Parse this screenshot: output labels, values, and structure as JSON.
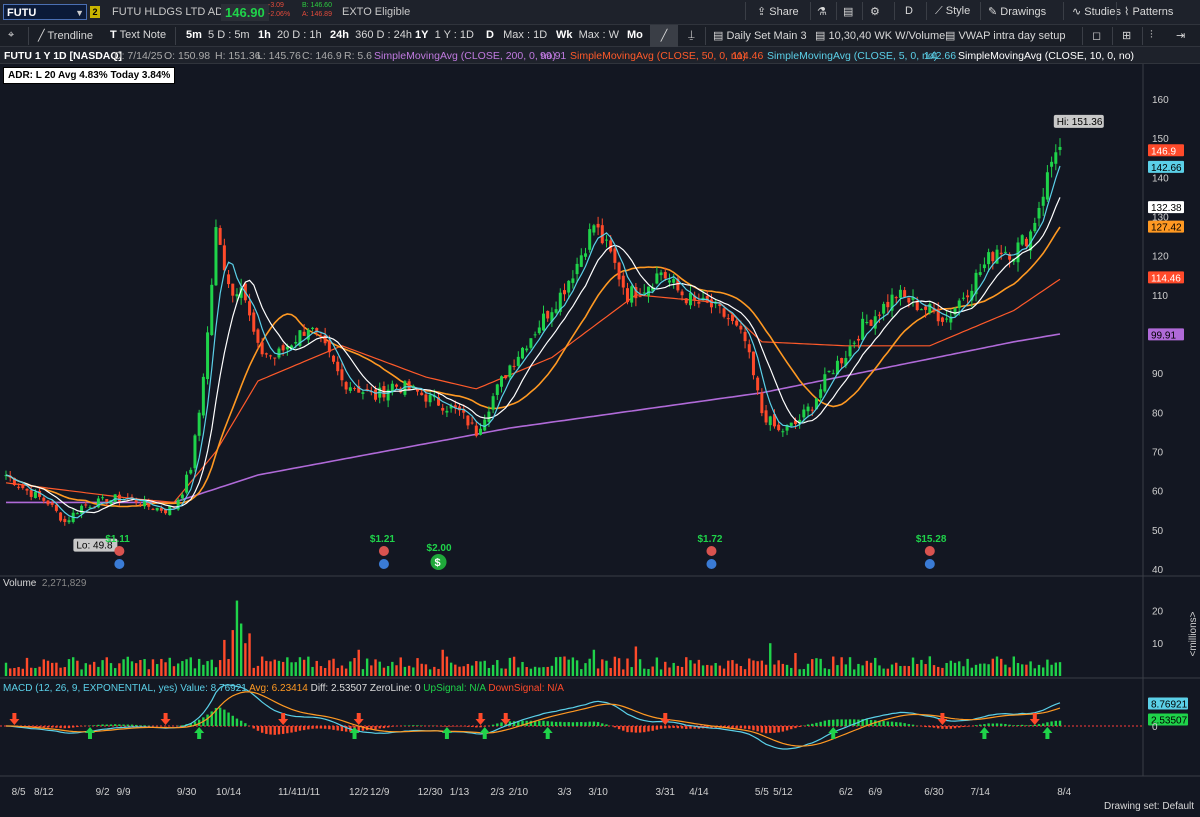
{
  "header": {
    "symbol": "FUTU",
    "link_badge": "2",
    "company_name": "FUTU HLDGS LTD ADR",
    "last_price": "146.90",
    "change": "-3.09",
    "change_pct": "-2.06%",
    "bid": "B: 146.60",
    "ask": "A: 146.89",
    "eligible": "EXTO Eligible",
    "share": "Share",
    "period": "D",
    "style": "Style",
    "drawings": "Drawings",
    "studies": "Studies",
    "patterns": "Patterns"
  },
  "toolbar": {
    "trendline": "Trendline",
    "text_note": "Text Note",
    "tf": [
      {
        "key": "5m",
        "label": "5 D : 5m"
      },
      {
        "key": "1h",
        "label": "20 D : 1h"
      },
      {
        "key": "24h",
        "label": "360 D : 24h"
      },
      {
        "key": "1Y",
        "label": "1 Y : 1D"
      },
      {
        "key": "D",
        "label": "Max : 1D"
      },
      {
        "key": "Wk",
        "label": "Max : W"
      },
      {
        "key": "Mo",
        "label": ""
      }
    ],
    "set1": "Daily Set Main 3",
    "set2": "10,30,40 WK W/Volume",
    "set3": "VWAP intra day setup"
  },
  "study_line": {
    "title": "FUTU 1 Y 1D [NASDAQ]",
    "date": "D: 7/14/25",
    "open": "O: 150.98",
    "high": "H: 151.36",
    "low": "L: 145.76",
    "close": "C: 146.9",
    "range": "R: 5.6",
    "sma200": "SimpleMovingAvg (CLOSE, 200, 0, no)",
    "sma200_val": "99.91",
    "sma50": "SimpleMovingAvg (CLOSE, 50, 0, no)",
    "sma50_val": "114.46",
    "sma5": "SimpleMovingAvg (CLOSE, 5, 0, no)",
    "sma5_val": "142.66",
    "sma10": "SimpleMovingAvg (CLOSE, 10, 0, no)"
  },
  "adr_label": "ADR: L 20  Avg 4.83%  Today 3.84%",
  "hi_label": "Hi: 151.36",
  "lo_label": "Lo: 49.8",
  "volume_header": "Volume",
  "volume_value": "2,271,829",
  "volume_unit": "<millions>",
  "macd_header": {
    "name": "MACD (12, 26, 9, EXPONENTIAL, yes)",
    "value": "Value: 8.76921",
    "avg": "Avg: 6.23414",
    "diff": "Diff: 2.53507",
    "zeroline": "ZeroLine: 0",
    "up": "UpSignal: N/A",
    "down": "DownSignal: N/A"
  },
  "drawing_set": "Drawing set: Default",
  "colors": {
    "up": "#1fd34a",
    "down": "#ff4a2a",
    "sma5": "#5bd0e8",
    "sma10": "#ffffff",
    "sma20": "#ff9922",
    "sma50": "#ff5a2a",
    "sma200": "#b06ad8",
    "macd": "#5bd0e8",
    "macd_avg": "#ff9922"
  },
  "chart_data": [
    {
      "type": "candlestick",
      "ylim": [
        40,
        163
      ],
      "yticks": [
        40,
        50,
        60,
        70,
        80,
        90,
        100,
        110,
        120,
        130,
        140,
        150,
        160
      ],
      "x_ticks": [
        "8/5",
        "8/12",
        "9/2",
        "9/9",
        "9/30",
        "10/14",
        "11/4",
        "11/11",
        "12/2",
        "12/9",
        "12/30",
        "1/13",
        "2/3",
        "2/10",
        "3/3",
        "3/10",
        "3/31",
        "4/14",
        "5/5",
        "5/12",
        "6/2",
        "6/9",
        "6/30",
        "7/14",
        "8/4"
      ],
      "price_path": [
        [
          0,
          64
        ],
        [
          5,
          60
        ],
        [
          10,
          57
        ],
        [
          14,
          52
        ],
        [
          18,
          56
        ],
        [
          22,
          57
        ],
        [
          26,
          58
        ],
        [
          30,
          58
        ],
        [
          34,
          56
        ],
        [
          38,
          55
        ],
        [
          40,
          56
        ],
        [
          42,
          60
        ],
        [
          44,
          66
        ],
        [
          46,
          80
        ],
        [
          48,
          100
        ],
        [
          50,
          126
        ],
        [
          52,
          118
        ],
        [
          54,
          110
        ],
        [
          56,
          114
        ],
        [
          58,
          104
        ],
        [
          60,
          96
        ],
        [
          64,
          94
        ],
        [
          68,
          98
        ],
        [
          72,
          102
        ],
        [
          76,
          96
        ],
        [
          80,
          88
        ],
        [
          84,
          86
        ],
        [
          88,
          84
        ],
        [
          92,
          87
        ],
        [
          96,
          86
        ],
        [
          100,
          84
        ],
        [
          104,
          82
        ],
        [
          108,
          80
        ],
        [
          112,
          75
        ],
        [
          116,
          84
        ],
        [
          120,
          92
        ],
        [
          124,
          98
        ],
        [
          128,
          104
        ],
        [
          132,
          110
        ],
        [
          136,
          118
        ],
        [
          140,
          128
        ],
        [
          144,
          120
        ],
        [
          148,
          110
        ],
        [
          152,
          112
        ],
        [
          156,
          116
        ],
        [
          160,
          111
        ],
        [
          164,
          108
        ],
        [
          168,
          107
        ],
        [
          172,
          104
        ],
        [
          176,
          98
        ],
        [
          180,
          80
        ],
        [
          184,
          75
        ],
        [
          188,
          77
        ],
        [
          192,
          82
        ],
        [
          196,
          90
        ],
        [
          200,
          95
        ],
        [
          204,
          102
        ],
        [
          208,
          106
        ],
        [
          212,
          110
        ],
        [
          216,
          108
        ],
        [
          220,
          106
        ],
        [
          224,
          104
        ],
        [
          228,
          110
        ],
        [
          232,
          116
        ],
        [
          236,
          122
        ],
        [
          240,
          121
        ],
        [
          244,
          126
        ],
        [
          248,
          140
        ],
        [
          250,
          148
        ],
        [
          251,
          147
        ]
      ],
      "sma200_path": [
        [
          0,
          57
        ],
        [
          40,
          57
        ],
        [
          60,
          64
        ],
        [
          120,
          76
        ],
        [
          180,
          85
        ],
        [
          240,
          98
        ],
        [
          251,
          100
        ]
      ],
      "sma50_path": [
        [
          0,
          62
        ],
        [
          30,
          58
        ],
        [
          40,
          57
        ],
        [
          50,
          70
        ],
        [
          60,
          88
        ],
        [
          80,
          97
        ],
        [
          100,
          89
        ],
        [
          112,
          86
        ],
        [
          130,
          94
        ],
        [
          150,
          110
        ],
        [
          170,
          108
        ],
        [
          180,
          98
        ],
        [
          200,
          97
        ],
        [
          220,
          97
        ],
        [
          240,
          106
        ],
        [
          251,
          114
        ]
      ],
      "labels": {
        "hi": 151.36,
        "lo": 49.8,
        "last": 146.9,
        "sma5": 142.66,
        "sma10": 132.38,
        "sma20": 127.42,
        "sma50": 114.46,
        "sma200": 99.91
      },
      "events": [
        {
          "idx": 27,
          "dividend": "1.11"
        },
        {
          "idx": 90,
          "dividend": "1.21"
        },
        {
          "idx": 103,
          "special": "2.00"
        },
        {
          "idx": 168,
          "dividend": "1.72"
        },
        {
          "idx": 220,
          "dividend": "15.28"
        }
      ]
    },
    {
      "type": "bar",
      "title": "Volume",
      "ylim": [
        0,
        25
      ],
      "yticks": [
        10,
        20
      ],
      "spikes": [
        [
          55,
          23
        ],
        [
          54,
          14
        ],
        [
          56,
          16
        ],
        [
          52,
          11
        ],
        [
          58,
          13
        ],
        [
          57,
          10
        ],
        [
          84,
          8
        ],
        [
          104,
          8
        ],
        [
          140,
          8
        ],
        [
          150,
          9
        ],
        [
          182,
          10
        ],
        [
          188,
          7
        ],
        [
          220,
          6
        ],
        [
          248,
          5
        ]
      ]
    },
    {
      "type": "line",
      "title": "MACD",
      "ylim": [
        -8,
        14
      ],
      "value": 8.76921,
      "avg": 6.23414,
      "diff": 2.53507,
      "up_arrows": [
        20,
        46,
        83,
        105,
        114,
        129,
        197,
        233,
        248
      ],
      "down_arrows": [
        2,
        38,
        66,
        84,
        113,
        119,
        157,
        223,
        245
      ]
    }
  ]
}
